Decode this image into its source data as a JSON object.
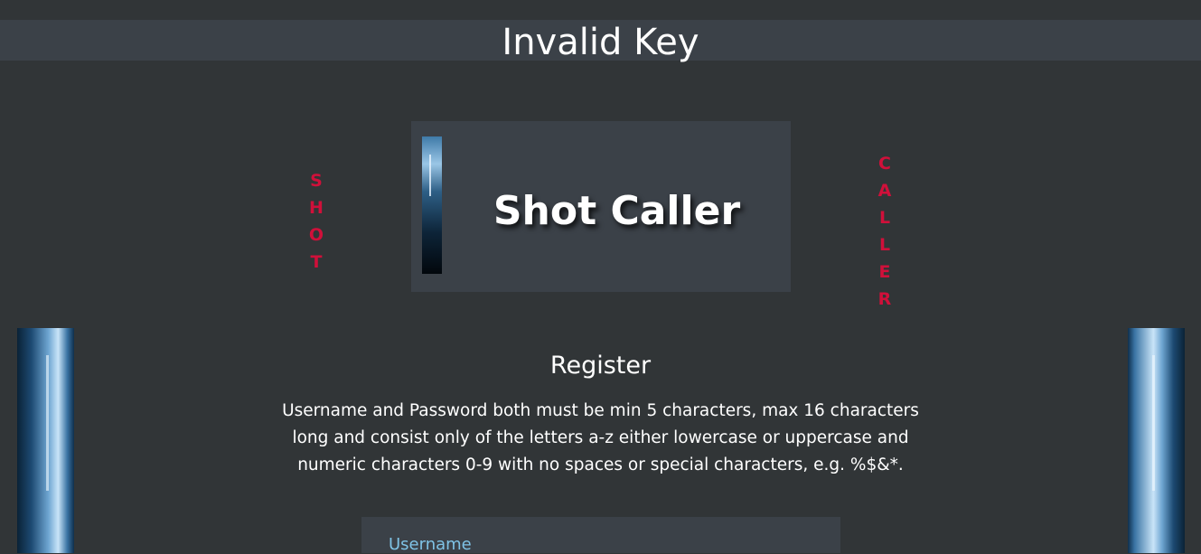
{
  "header": {
    "title": "Invalid Key"
  },
  "brand": {
    "left_word_letters": [
      "S",
      "H",
      "O",
      "T"
    ],
    "right_word_letters": [
      "C",
      "A",
      "L",
      "L",
      "E",
      "R"
    ],
    "logo_text": "Shot Caller",
    "accent_color": "#d0103a"
  },
  "register": {
    "heading": "Register",
    "rules": "Username and Password both must be min 5 characters, max 16 characters long and consist only of the letters a-z either lowercase or uppercase and numeric characters 0-9 with no spaces or special characters, e.g. %$&*.",
    "username_label": "Username"
  }
}
